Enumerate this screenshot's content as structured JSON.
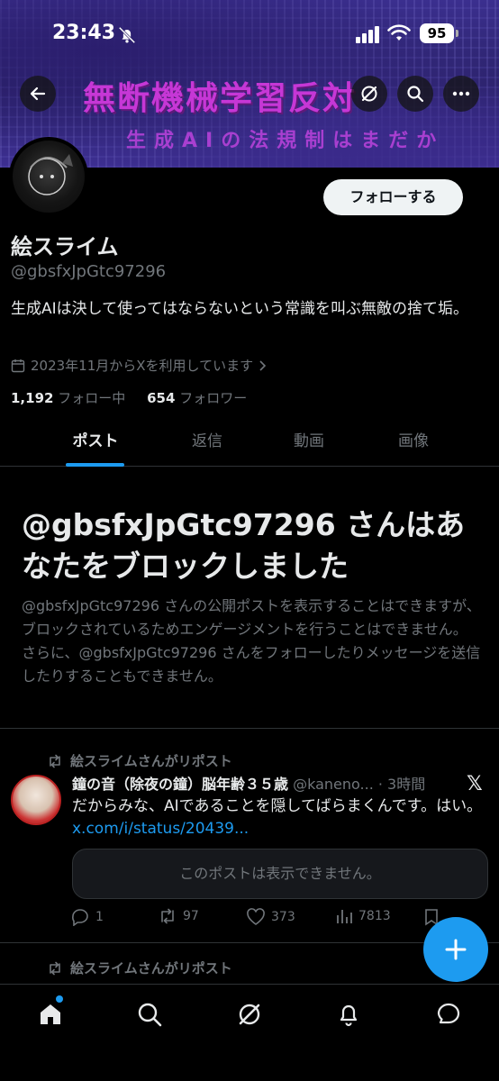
{
  "status_bar": {
    "time": "23:43",
    "battery": "95"
  },
  "banner": {
    "title": "無断機械学習反対",
    "subtitle": "生成AIの法規制はまだか"
  },
  "profile": {
    "name": "絵スライム",
    "handle": "@gbsfxJpGtc97296",
    "bio": "生成AIは決して使ってはならないという常識を叫ぶ無敵の捨て垢。",
    "joined": "2023年11月からXを利用しています",
    "following_count": "1,192",
    "following_label": "フォロー中",
    "followers_count": "654",
    "followers_label": "フォロワー",
    "follow_button": "フォローする"
  },
  "tabs": [
    {
      "label": "ポスト"
    },
    {
      "label": "返信"
    },
    {
      "label": "動画"
    },
    {
      "label": "画像"
    }
  ],
  "blocked": {
    "title": "@gbsfxJpGtc97296 さんはあなたをブロックしました",
    "text": "@gbsfxJpGtc97296 さんの公開ポストを表示することはできますが、ブロックされているためエンゲージメントを行うことはできません。さらに、@gbsfxJpGtc97296 さんをフォローしたりメッセージを送信したりすることもできません。"
  },
  "posts": [
    {
      "repost_label": "絵スライムさんがリポスト",
      "author": "鐘の音（除夜の鐘）脳年齢３５歳",
      "handle_time": "@kaneno... · 3時間",
      "text": "だからみな、AIであることを隠してばらまくんです。はい。",
      "link": "x.com/i/status/20439...",
      "quote": "このポストは表示できません。",
      "replies": "1",
      "reposts": "97",
      "likes": "373",
      "views": "7813"
    },
    {
      "repost_label": "絵スライムさんがリポスト"
    }
  ],
  "colors": {
    "accent": "#1d9bf0",
    "background": "#000000",
    "muted": "#71767b"
  }
}
